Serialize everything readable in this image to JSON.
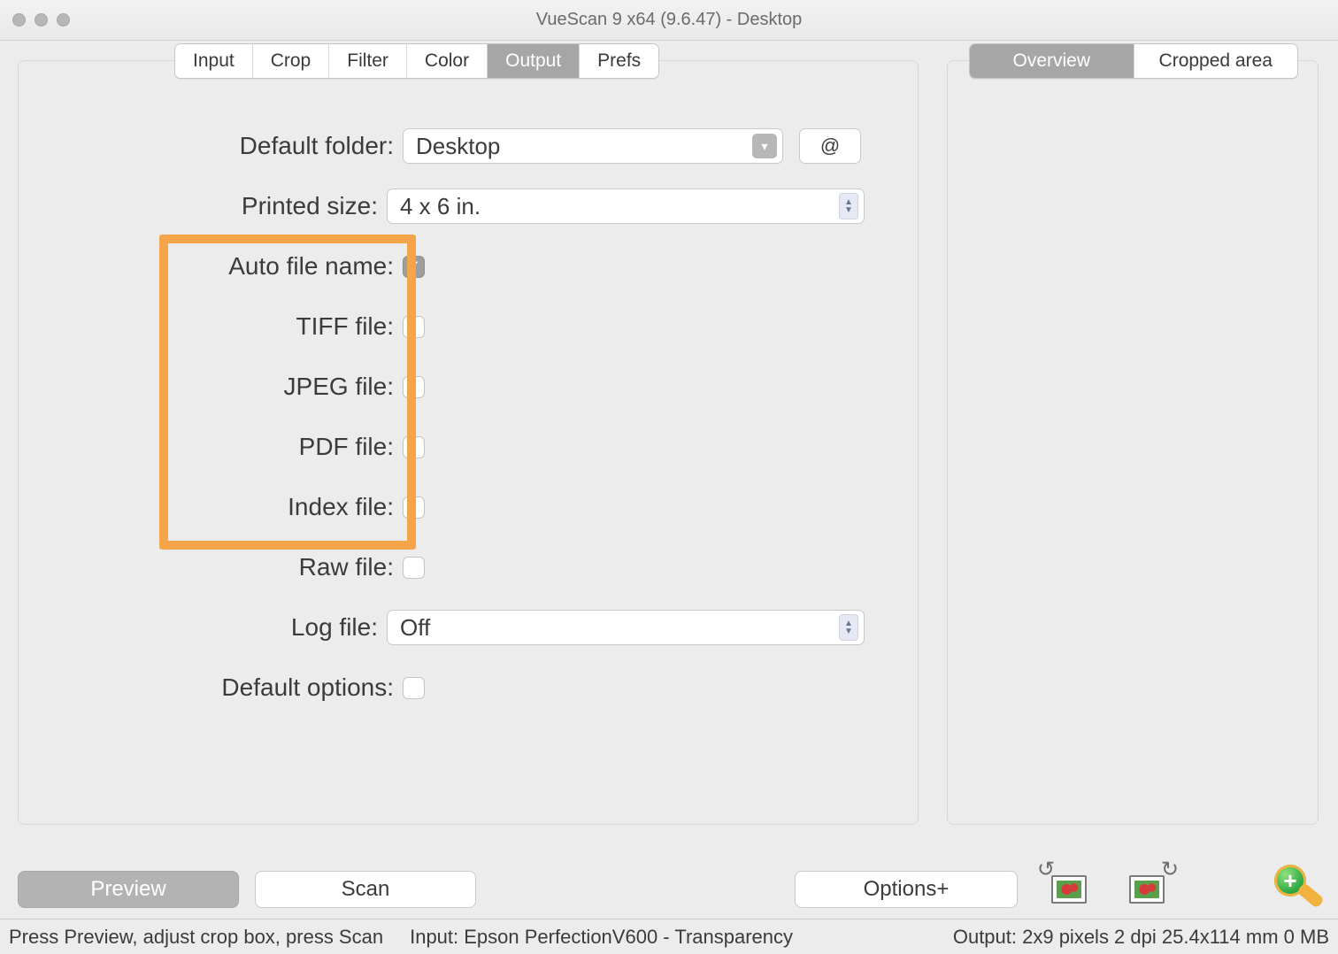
{
  "window": {
    "title": "VueScan 9 x64 (9.6.47) - Desktop"
  },
  "leftTabs": {
    "items": [
      "Input",
      "Crop",
      "Filter",
      "Color",
      "Output",
      "Prefs"
    ],
    "activeIndex": 4
  },
  "rightTabs": {
    "items": [
      "Overview",
      "Cropped area"
    ],
    "activeIndex": 0
  },
  "form": {
    "default_folder": {
      "label": "Default folder:",
      "value": "Desktop",
      "at_label": "@"
    },
    "printed_size": {
      "label": "Printed size:",
      "value": "4 x 6 in."
    },
    "auto_file_name": {
      "label": "Auto file name:",
      "checked": true
    },
    "tiff_file": {
      "label": "TIFF file:",
      "checked": false
    },
    "jpeg_file": {
      "label": "JPEG file:",
      "checked": false
    },
    "pdf_file": {
      "label": "PDF file:",
      "checked": false
    },
    "index_file": {
      "label": "Index file:",
      "checked": false
    },
    "raw_file": {
      "label": "Raw file:",
      "checked": false
    },
    "log_file": {
      "label": "Log file:",
      "value": "Off"
    },
    "default_options": {
      "label": "Default options:",
      "checked": false
    }
  },
  "bottom": {
    "preview": "Preview",
    "scan": "Scan",
    "options": "Options+"
  },
  "status": {
    "hint": "Press Preview, adjust crop box, press Scan",
    "input": "Input: Epson PerfectionV600 - Transparency",
    "output": "Output: 2x9 pixels 2 dpi 25.4x114 mm 0 MB"
  },
  "icons": {
    "zoom_plus": "+"
  }
}
